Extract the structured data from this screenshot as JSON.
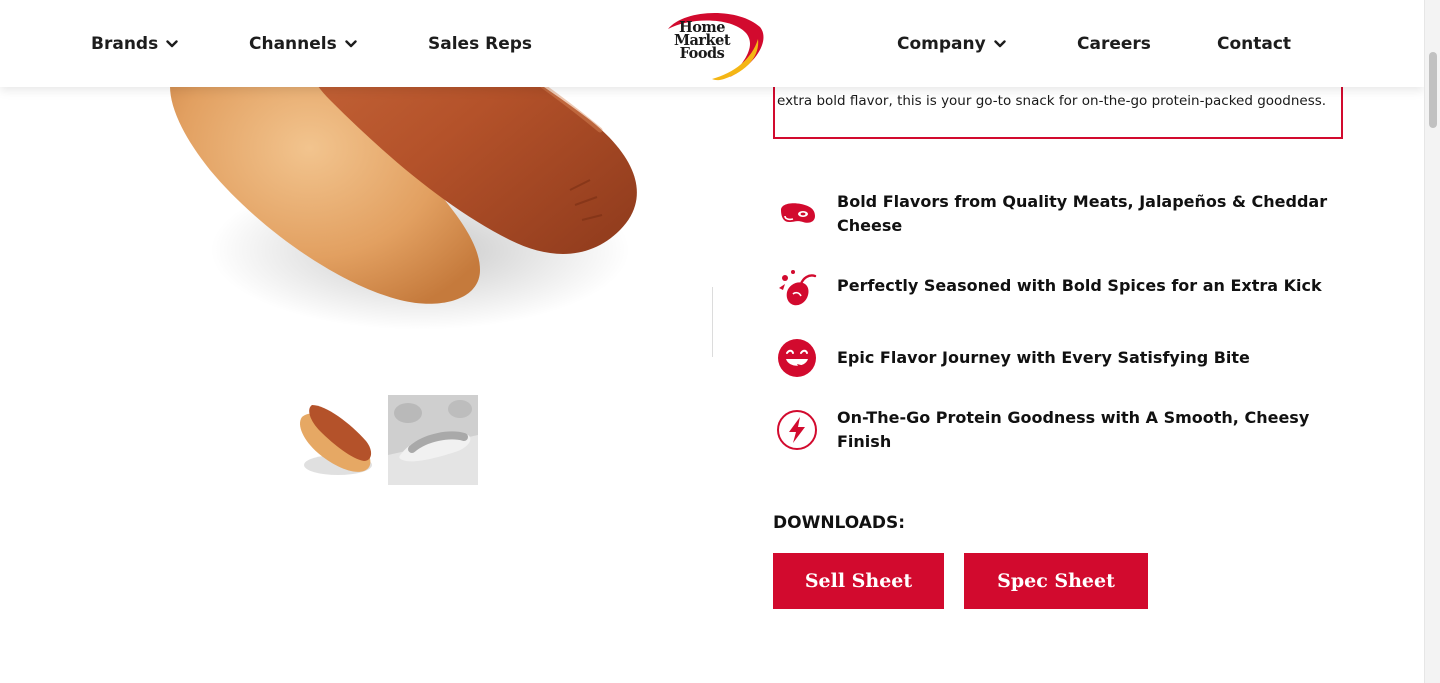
{
  "nav": {
    "brands": "Brands",
    "channels": "Channels",
    "sales_reps": "Sales Reps",
    "company": "Company",
    "careers": "Careers",
    "contact": "Contact"
  },
  "logo": {
    "line1": "Home",
    "line2": "Market",
    "line3": "Foods"
  },
  "description": "extra bold flavor, this is your go-to snack for on-the-go protein-packed goodness.",
  "features": [
    {
      "icon": "steak-icon",
      "text": "Bold Flavors from Quality Meats, Jalapeños & Cheddar Cheese"
    },
    {
      "icon": "spices-icon",
      "text": "Perfectly Seasoned with Bold Spices for an Extra Kick"
    },
    {
      "icon": "happy-face-icon",
      "text": "Epic Flavor Journey with Every Satisfying Bite"
    },
    {
      "icon": "lightning-icon",
      "text": "On-The-Go Protein Goodness with A Smooth, Cheesy Finish"
    }
  ],
  "downloads": {
    "title": "DOWNLOADS:",
    "sell_sheet": "Sell Sheet",
    "spec_sheet": "Spec Sheet"
  },
  "colors": {
    "brand_red": "#d20a2e",
    "logo_yellow": "#f4b615"
  }
}
